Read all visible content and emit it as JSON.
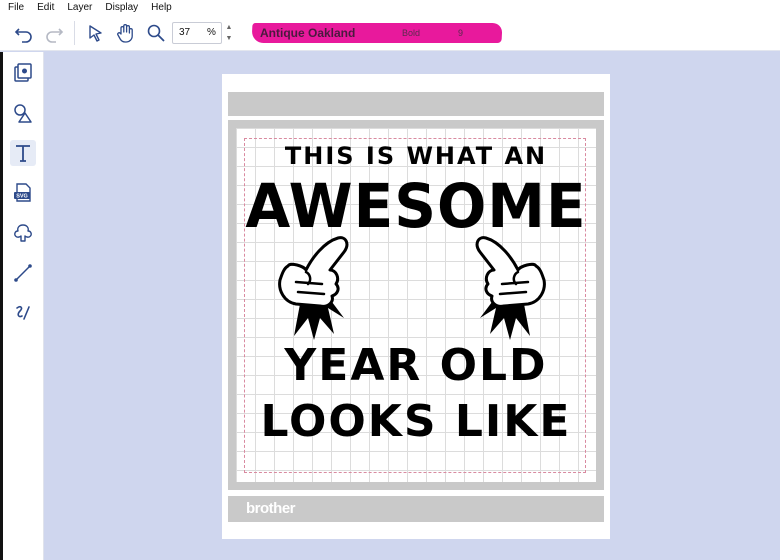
{
  "menu": [
    "File",
    "Edit",
    "Layer",
    "Display",
    "Help"
  ],
  "toolbar": {
    "zoom_value": "37",
    "zoom_unit": "%",
    "font_name": "Antique Oakland",
    "font_style": "Bold",
    "font_size": "9"
  },
  "icons": {
    "undo": "undo-icon",
    "redo": "redo-icon",
    "select": "pointer-icon",
    "pan": "hand-icon",
    "zoom": "magnifier-icon"
  },
  "sidebar": {
    "tools": [
      "pattern-tool",
      "shape-tool",
      "text-tool",
      "svg-tool",
      "outline-tool",
      "line-tool",
      "freehand-tool"
    ],
    "svg_label": "SVG",
    "active": "text-tool"
  },
  "canvas": {
    "line1": "THIS IS WHAT AN",
    "line2": "AWESOME",
    "line3": "YEAR OLD",
    "line4": "LOOKS LIKE",
    "mat_brand": "brother"
  },
  "colors": {
    "accent": "#e8199c",
    "workspace": "#cfd6ee",
    "mat": "#c9c9c9",
    "icon": "#2d4a8a"
  }
}
